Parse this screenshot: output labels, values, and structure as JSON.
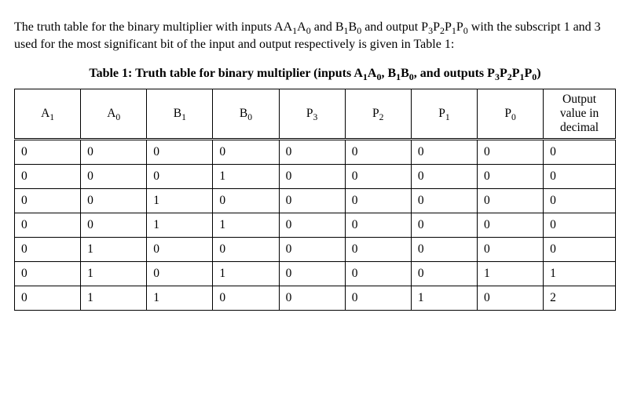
{
  "intro": {
    "part1": "The truth table for the binary multiplier with inputs A",
    "A1_sub": "1",
    "part2": "A",
    "A0_sub": "0",
    "part3": " and B",
    "B1_sub": "1",
    "part4": "B",
    "B0_sub": "0",
    "part5": " and output P",
    "P3_sub": "3",
    "part6": "P",
    "P2_sub": "2",
    "part7": "P",
    "P1_sub": "1",
    "part8": "P",
    "P0_sub": "0",
    "part9": " with the subscript 1 and 3 used for the most significant bit of the input and output respectively is given in Table 1:"
  },
  "table_title": {
    "t1": "Table 1: Truth table for binary multiplier (inputs A",
    "s1": "1",
    "t2": "A",
    "s2": "0",
    "t3": ", B",
    "s3": "1",
    "t4": "B",
    "s4": "0",
    "t5": ", and outputs P",
    "s5": "3",
    "t6": "P",
    "s6": "2",
    "t7": "P",
    "s7": "1",
    "t8": "P",
    "s8": "0",
    "t9": ")"
  },
  "headers": {
    "A1": {
      "base": "A",
      "sub": "1"
    },
    "A0": {
      "base": "A",
      "sub": "0"
    },
    "B1": {
      "base": "B",
      "sub": "1"
    },
    "B0": {
      "base": "B",
      "sub": "0"
    },
    "P3": {
      "base": "P",
      "sub": "3"
    },
    "P2": {
      "base": "P",
      "sub": "2"
    },
    "P1": {
      "base": "P",
      "sub": "1"
    },
    "P0": {
      "base": "P",
      "sub": "0"
    },
    "dec": "Output value in decimal"
  },
  "rows": [
    {
      "A1": "0",
      "A0": "0",
      "B1": "0",
      "B0": "0",
      "P3": "0",
      "P2": "0",
      "P1": "0",
      "P0": "0",
      "dec": "0"
    },
    {
      "A1": "0",
      "A0": "0",
      "B1": "0",
      "B0": "1",
      "P3": "0",
      "P2": "0",
      "P1": "0",
      "P0": "0",
      "dec": "0"
    },
    {
      "A1": "0",
      "A0": "0",
      "B1": "1",
      "B0": "0",
      "P3": "0",
      "P2": "0",
      "P1": "0",
      "P0": "0",
      "dec": "0"
    },
    {
      "A1": "0",
      "A0": "0",
      "B1": "1",
      "B0": "1",
      "P3": "0",
      "P2": "0",
      "P1": "0",
      "P0": "0",
      "dec": "0"
    },
    {
      "A1": "0",
      "A0": "1",
      "B1": "0",
      "B0": "0",
      "P3": "0",
      "P2": "0",
      "P1": "0",
      "P0": "0",
      "dec": "0"
    },
    {
      "A1": "0",
      "A0": "1",
      "B1": "0",
      "B0": "1",
      "P3": "0",
      "P2": "0",
      "P1": "0",
      "P0": "1",
      "dec": "1"
    },
    {
      "A1": "0",
      "A0": "1",
      "B1": "1",
      "B0": "0",
      "P3": "0",
      "P2": "0",
      "P1": "1",
      "P0": "0",
      "dec": "2"
    }
  ]
}
